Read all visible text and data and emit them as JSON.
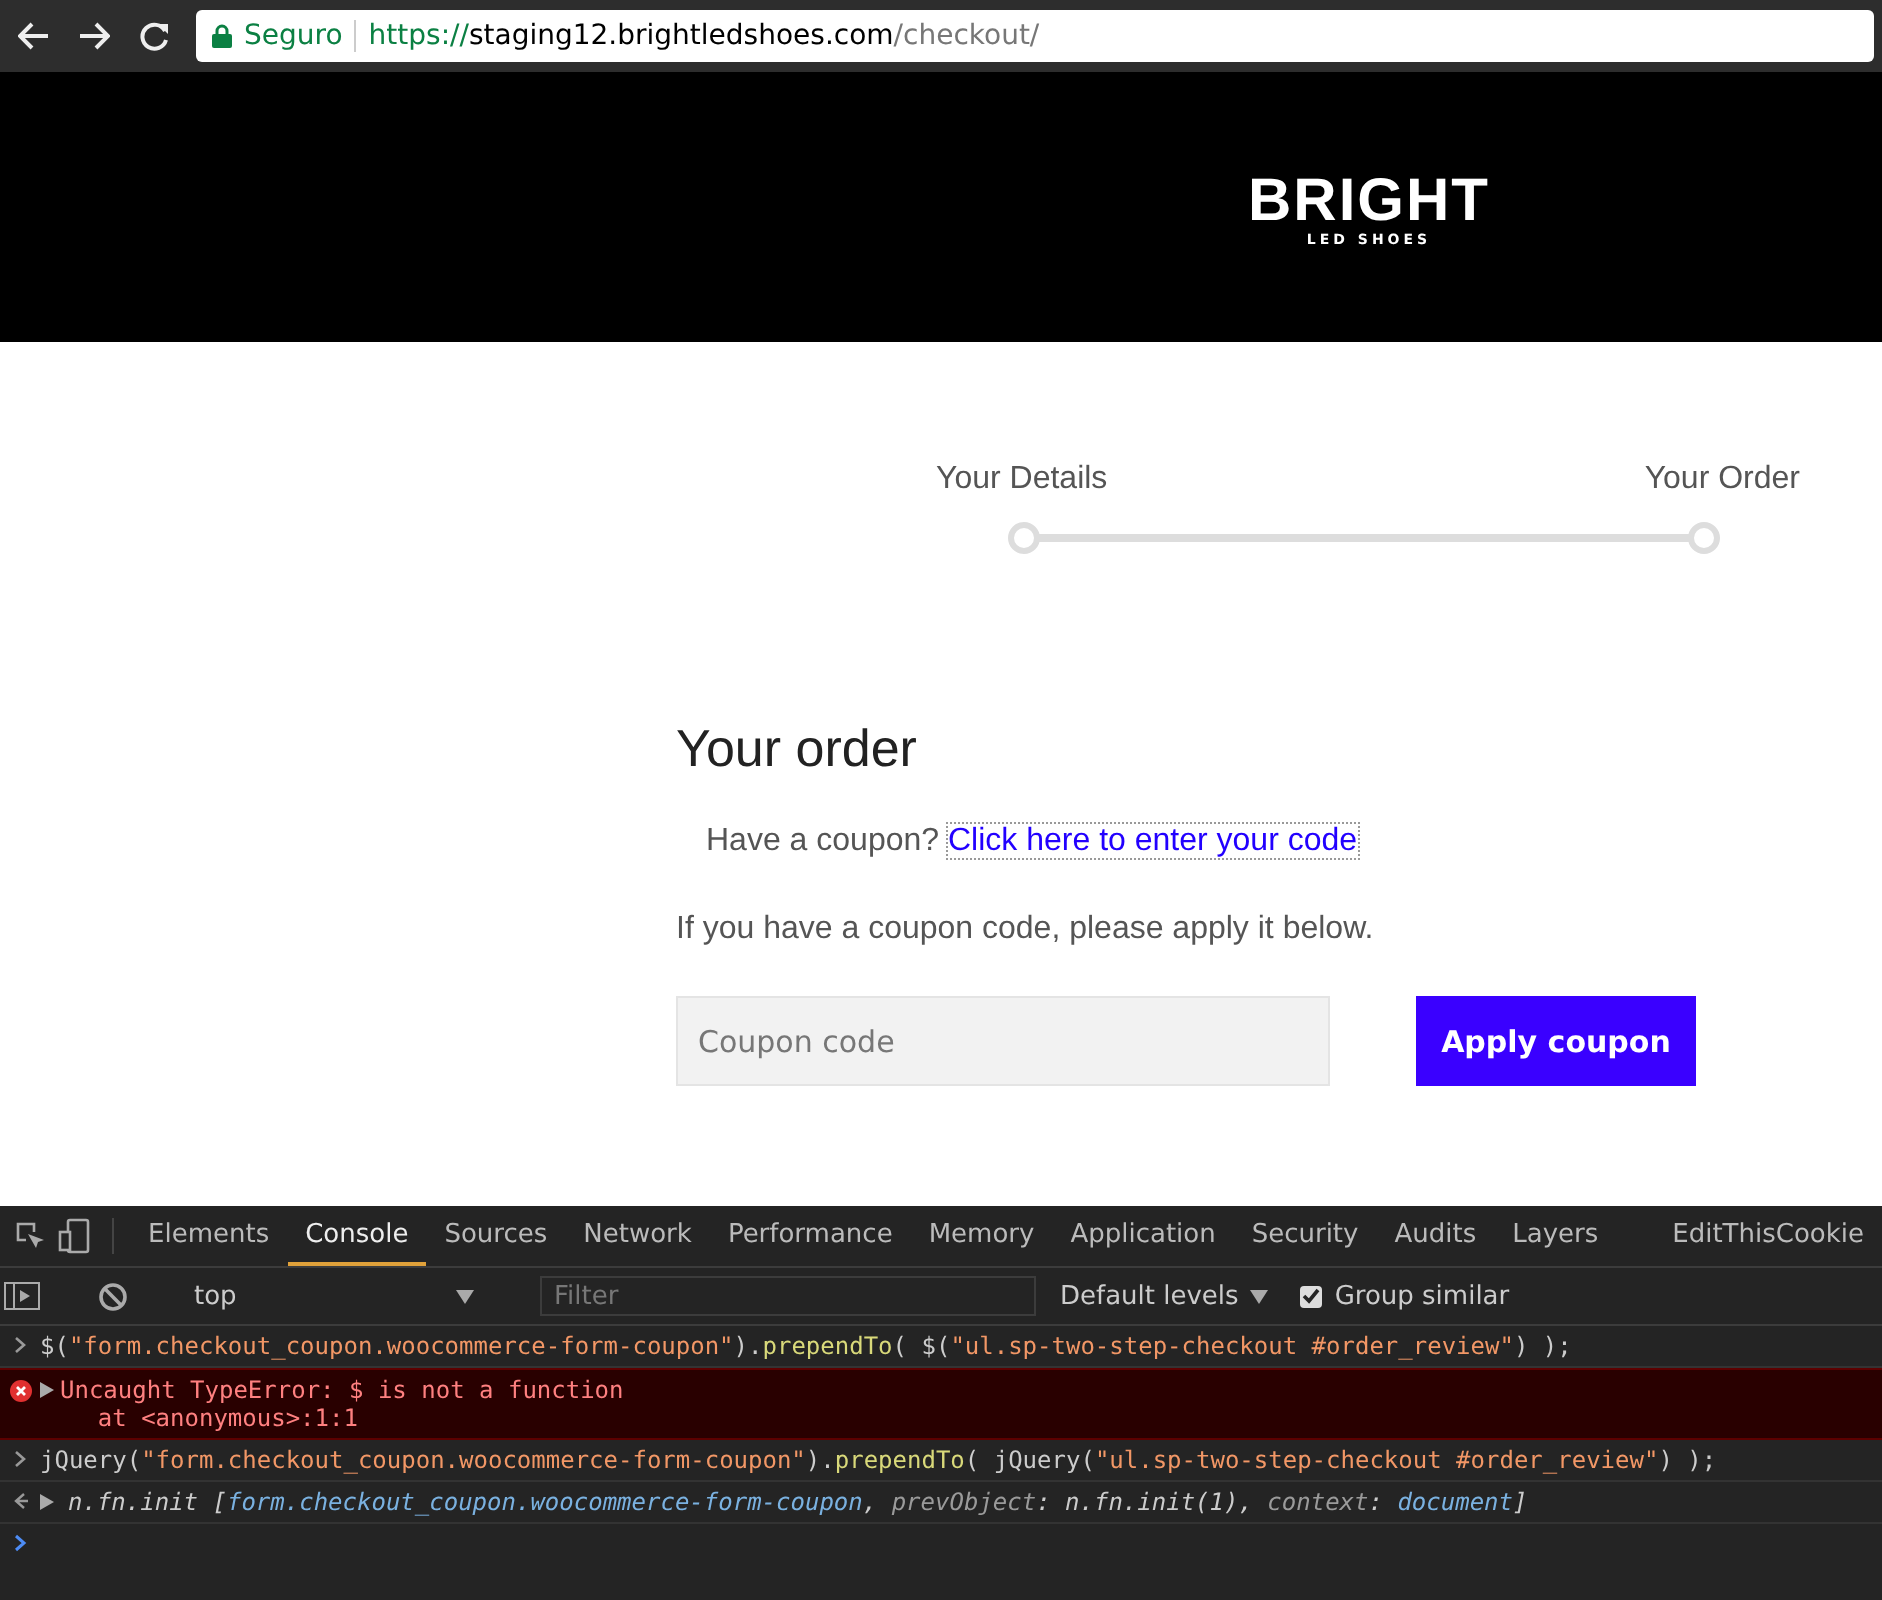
{
  "browser": {
    "security_label": "Seguro",
    "url_scheme": "https://",
    "url_host": "staging12.brightledshoes.com",
    "url_path": "/checkout/"
  },
  "header": {
    "logo_title": "BRIGHT",
    "logo_subtitle": "LED SHOES"
  },
  "steps": [
    {
      "label": "Your Details",
      "selected": false
    },
    {
      "label": "Your Order",
      "selected": false
    }
  ],
  "order": {
    "title": "Your order",
    "coupon_prompt": "Have a coupon?",
    "coupon_link": "Click here to enter your code",
    "coupon_info": "If you have a coupon code, please apply it below.",
    "coupon_placeholder": "Coupon code",
    "apply_button": "Apply coupon"
  },
  "devtools": {
    "tabs": [
      {
        "label": "Elements",
        "selected": false
      },
      {
        "label": "Console",
        "selected": true
      },
      {
        "label": "Sources",
        "selected": false
      },
      {
        "label": "Network",
        "selected": false
      },
      {
        "label": "Performance",
        "selected": false
      },
      {
        "label": "Memory",
        "selected": false
      },
      {
        "label": "Application",
        "selected": false
      },
      {
        "label": "Security",
        "selected": false
      },
      {
        "label": "Audits",
        "selected": false
      },
      {
        "label": "Layers",
        "selected": false
      },
      {
        "label": "EditThisCookie",
        "selected": false
      }
    ],
    "context": "top",
    "filter_placeholder": "Filter",
    "levels": "Default levels",
    "group_similar": {
      "label": "Group similar",
      "checked": true
    },
    "console": [
      {
        "kind": "input",
        "parts": [
          {
            "kind": "code",
            "text": "$("
          },
          {
            "kind": "string",
            "text": "\"form.checkout_coupon.woocommerce-form-coupon\""
          },
          {
            "kind": "code",
            "text": ")."
          },
          {
            "kind": "method",
            "text": "prependTo"
          },
          {
            "kind": "code",
            "text": "( $("
          },
          {
            "kind": "string",
            "text": "\"ul.sp-two-step-checkout #order_review\""
          },
          {
            "kind": "code",
            "text": ") );"
          }
        ]
      },
      {
        "kind": "error",
        "parts": [
          {
            "kind": "error",
            "text": "Uncaught TypeError: $ is not a function"
          }
        ],
        "detail": "    at <anonymous>:1:1"
      },
      {
        "kind": "input",
        "parts": [
          {
            "kind": "code",
            "text": "jQuery("
          },
          {
            "kind": "string",
            "text": "\"form.checkout_coupon.woocommerce-form-coupon\""
          },
          {
            "kind": "code",
            "text": ")."
          },
          {
            "kind": "method",
            "text": "prependTo"
          },
          {
            "kind": "code",
            "text": "( jQuery("
          },
          {
            "kind": "string",
            "text": "\"ul.sp-two-step-checkout #order_review\""
          },
          {
            "kind": "code",
            "text": ") );"
          }
        ]
      },
      {
        "kind": "result",
        "parts": [
          {
            "kind": "italic",
            "text": "n.fn.init ["
          },
          {
            "kind": "ref",
            "text": "form.checkout_coupon.woocommerce-form-coupon"
          },
          {
            "kind": "italic",
            "text": ", "
          },
          {
            "kind": "key",
            "text": "prevObject"
          },
          {
            "kind": "italic",
            "text": ": n.fn.init(1), "
          },
          {
            "kind": "key",
            "text": "context"
          },
          {
            "kind": "italic",
            "text": ": "
          },
          {
            "kind": "ref",
            "text": "document"
          },
          {
            "kind": "italic",
            "text": "]"
          }
        ]
      }
    ]
  }
}
